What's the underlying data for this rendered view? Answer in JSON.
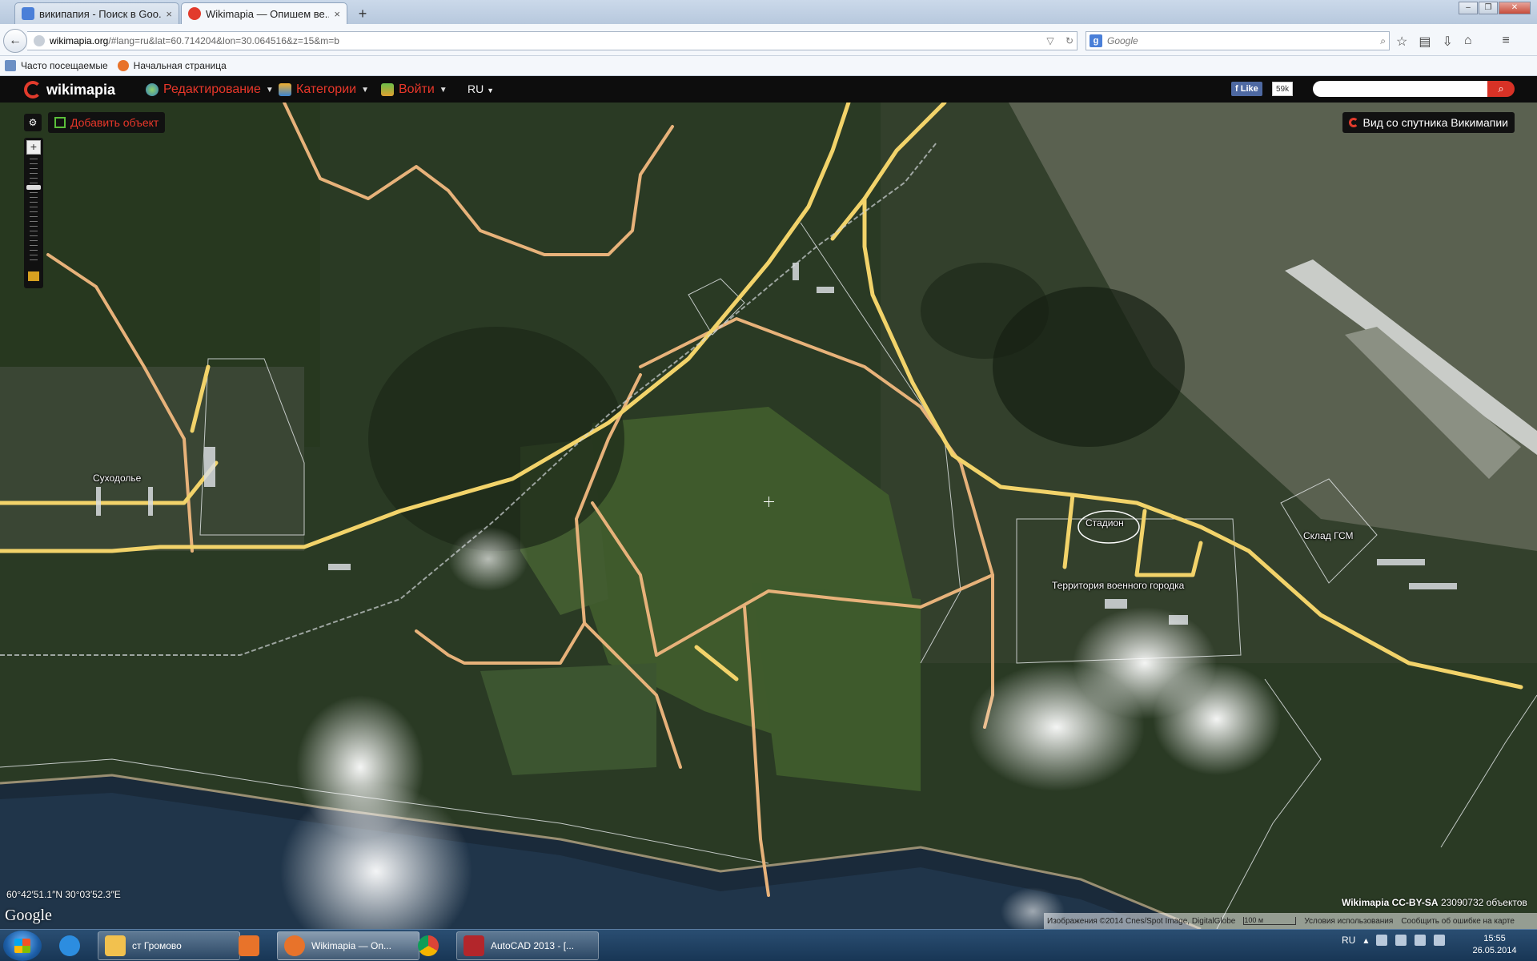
{
  "browser": {
    "tabs": [
      {
        "title": "википапия - Поиск в Goo...",
        "favicon_color": "#4a7fd8"
      },
      {
        "title": "Wikimapia — Опишем ве...",
        "favicon_color": "#e23b2c"
      }
    ],
    "new_tab_label": "+",
    "close_label": "×",
    "back_label": "←",
    "url_host": "wikimapia.org",
    "url_path": "/#lang=ru&lat=60.714204&lon=30.064516&z=15&m=b",
    "search_engine": "Google",
    "search_placeholder": "Google",
    "window_controls": [
      "–",
      "❐",
      "✕"
    ],
    "toolbar_icons": [
      "star-icon",
      "clipboard-icon",
      "download-icon",
      "home-icon",
      "menu-icon"
    ]
  },
  "bookmarks": [
    {
      "label": "Часто посещаемые"
    },
    {
      "label": "Начальная страница"
    }
  ],
  "wikimapia": {
    "logo_text": "wikimapia",
    "menu": [
      {
        "label": "Редактирование",
        "icon": "globe-icon"
      },
      {
        "label": "Категории",
        "icon": "list-icon"
      },
      {
        "label": "Войти",
        "icon": "login-icon"
      }
    ],
    "language": "RU",
    "fb_like": "Like",
    "fb_count": "59k",
    "search_button_icon": "search-icon"
  },
  "map": {
    "add_object_label": "Добавить объект",
    "satellite_view_label": "Вид со спутника Викимапии",
    "labels": {
      "sukhodolye": "Суходолье",
      "stadium": "Стадион",
      "military_town": "Территория военного городка",
      "fuel_depot": "Склад ГСМ"
    },
    "coordinates": "60°42′51.1″N 30°03′52.3″E",
    "google_logo": "Google",
    "license": "Wikimapia CC-BY-SA",
    "object_count": "23090732 объектов",
    "attribution": "Изображения ©2014 Cnes/Spot Image, DigitalGlobe",
    "scale": "100 м",
    "terms": "Условия использования",
    "report_error": "Сообщить об ошибке на карте",
    "zoom_level_fraction": 0.75
  },
  "taskbar": {
    "items": [
      {
        "label": "",
        "icon": "ie-icon",
        "color": "#2c8de0",
        "pinned": true
      },
      {
        "label": "ст Громово",
        "icon": "folder-icon",
        "color": "#f2c14e",
        "pinned": false
      },
      {
        "label": "",
        "icon": "media-player-icon",
        "color": "#e8732a",
        "pinned": true
      },
      {
        "label": "Wikimapia — On...",
        "icon": "firefox-icon",
        "color": "#e8732a",
        "pinned": false,
        "active": true
      },
      {
        "label": "",
        "icon": "chrome-icon",
        "color": "#3aa757",
        "pinned": true
      },
      {
        "label": "AutoCAD 2013 - [...",
        "icon": "autocad-icon",
        "color": "#b3262b",
        "pinned": false
      }
    ],
    "tray_lang": "RU",
    "time": "15:55",
    "date": "26.05.2014"
  }
}
